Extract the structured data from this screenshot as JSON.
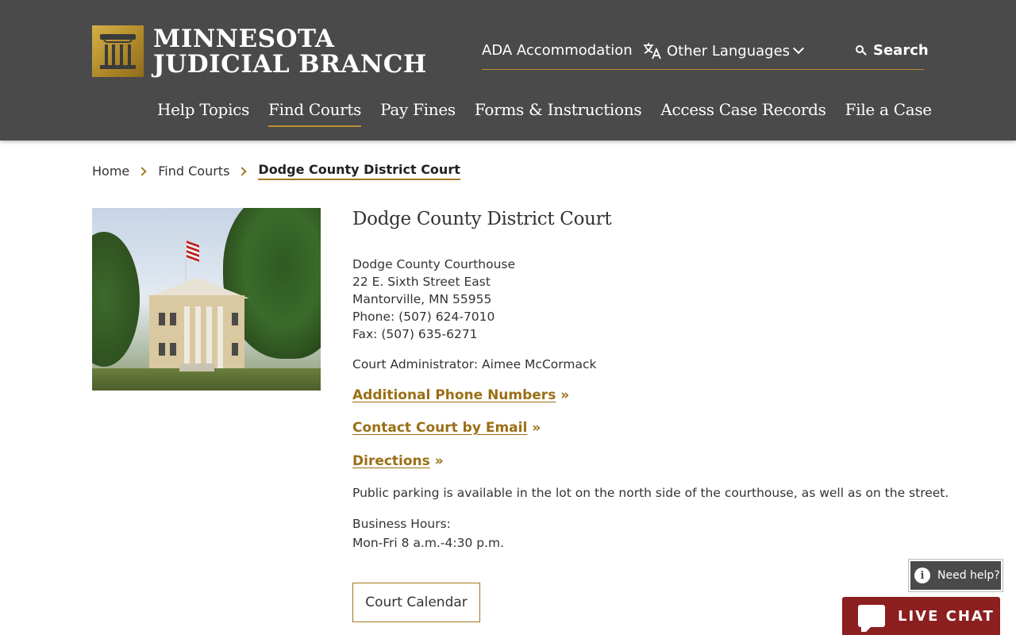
{
  "header": {
    "logo_line1": "MINNESOTA",
    "logo_line2": "JUDICIAL BRANCH",
    "utility": {
      "ada": "ADA Accommodation",
      "languages": "Other Languages",
      "search": "Search"
    },
    "nav": [
      {
        "label": "Help Topics",
        "active": false
      },
      {
        "label": "Find Courts",
        "active": true
      },
      {
        "label": "Pay Fines",
        "active": false
      },
      {
        "label": "Forms & Instructions",
        "active": false
      },
      {
        "label": "Access Case Records",
        "active": false
      },
      {
        "label": "File a Case",
        "active": false
      }
    ]
  },
  "breadcrumb": [
    "Home",
    "Find Courts",
    "Dodge County District Court"
  ],
  "court": {
    "title": "Dodge County District Court",
    "address": [
      "Dodge County Courthouse",
      "22 E. Sixth Street East",
      "Mantorville, MN 55955",
      "Phone: (507) 624-7010",
      "Fax: (507) 635-6271"
    ],
    "administrator": "Court Administrator: Aimee McCormack",
    "links": [
      {
        "text": "Additional Phone Numbers",
        "suffix": " »"
      },
      {
        "text": "Contact Court by Email",
        "suffix": " »"
      },
      {
        "text": "Directions",
        "suffix": " »"
      }
    ],
    "parking": "Public parking is available in the lot on the north side of the courthouse, as well as on the street.",
    "hours_label": "Business Hours:",
    "hours_value": "Mon-Fri 8 a.m.-4:30 p.m.",
    "calendar_button": "Court Calendar"
  },
  "widgets": {
    "need_help": "Need help?",
    "info_glyph": "i",
    "live_chat": "LIVE CHAT"
  },
  "colors": {
    "header_bg": "#4a4a4a",
    "accent_gold": "#9a6f16",
    "chat_red": "#8c1f1f"
  }
}
